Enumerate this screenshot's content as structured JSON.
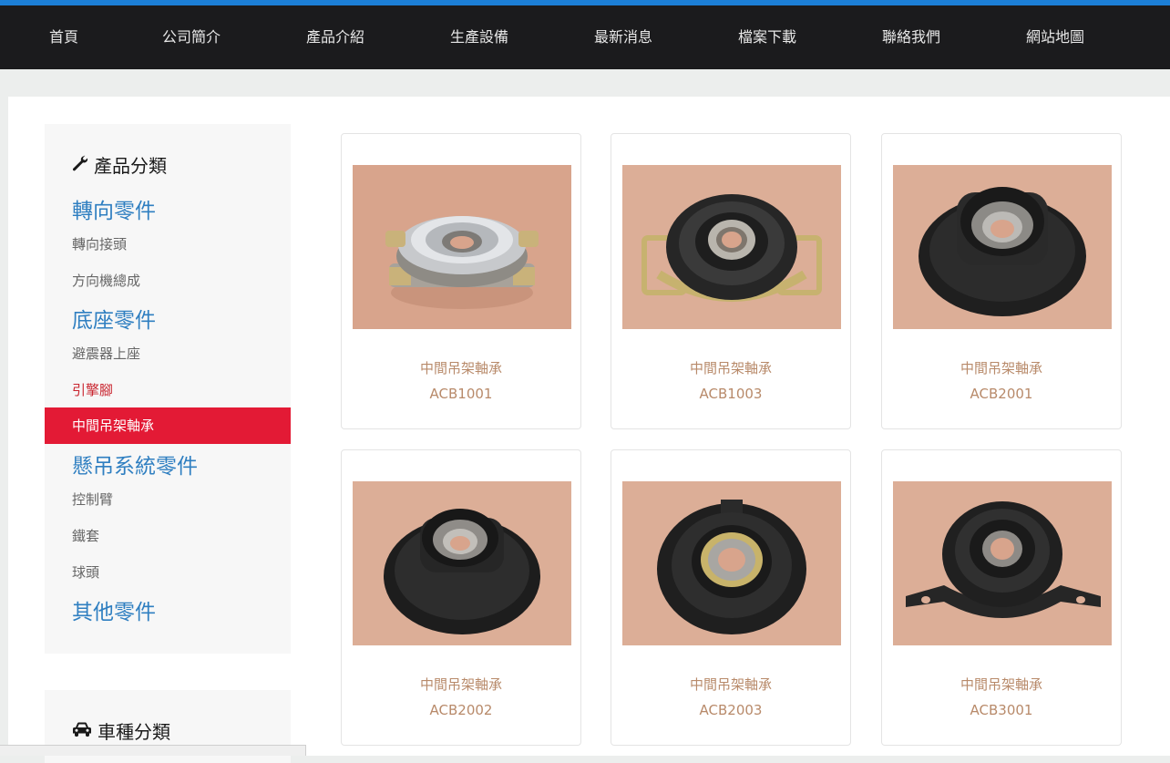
{
  "nav": {
    "items": [
      "首頁",
      "公司簡介",
      "產品介紹",
      "生產設備",
      "最新消息",
      "檔案下載",
      "聯絡我們",
      "網站地圖"
    ]
  },
  "sidebar": {
    "heading": "產品分類",
    "heading_icon": "wrench-icon",
    "groups": [
      {
        "label": "轉向零件",
        "items": [
          "轉向接頭",
          "方向機總成"
        ]
      },
      {
        "label": "底座零件",
        "items": [
          "避震器上座",
          "引擎腳",
          "中間吊架軸承"
        ]
      },
      {
        "label": "懸吊系統零件",
        "items": [
          "控制臂",
          "鐵套",
          "球頭"
        ]
      },
      {
        "label": "其他零件",
        "items": []
      }
    ],
    "active_item": "中間吊架軸承",
    "highlight_item": "引擎腳",
    "vehicle_heading": "車種分類",
    "vehicle_heading_icon": "car-icon"
  },
  "products": [
    {
      "name": "中間吊架軸承",
      "code": "ACB1001"
    },
    {
      "name": "中間吊架軸承",
      "code": "ACB1003"
    },
    {
      "name": "中間吊架軸承",
      "code": "ACB2001"
    },
    {
      "name": "中間吊架軸承",
      "code": "ACB2002"
    },
    {
      "name": "中間吊架軸承",
      "code": "ACB2003"
    },
    {
      "name": "中間吊架軸承",
      "code": "ACB3001"
    }
  ],
  "colors": {
    "accent": "#1c7fd6",
    "nav_bg": "#1b1b1d",
    "category": "#2f7fc1",
    "active_bg": "#e31a35",
    "product_text": "#b88a6a"
  }
}
